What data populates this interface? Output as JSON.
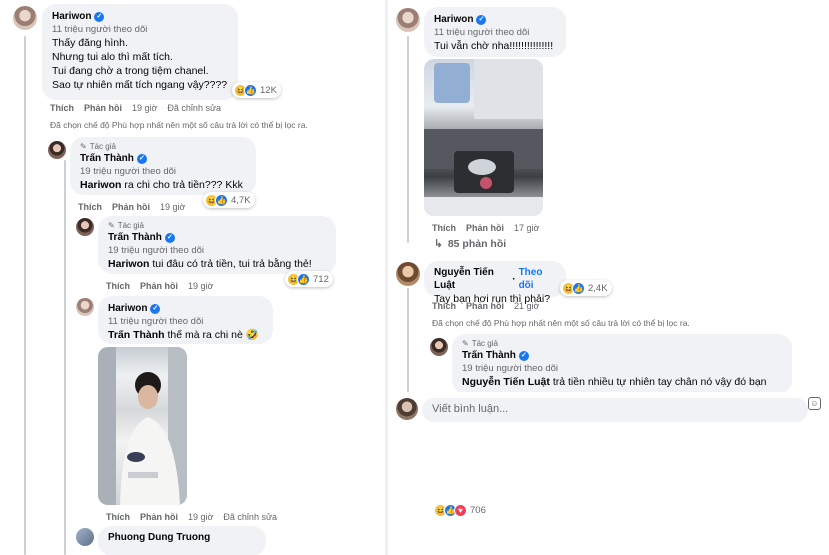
{
  "left": {
    "c1": {
      "name": "Hariwon",
      "followers": "11 triệu người theo dõi",
      "lines": [
        "Thấy đăng hình.",
        "Nhưng tui alo thì mất tích.",
        "Tui đang chờ a trong tiệm chanel.",
        "Sao tự nhiên mất tích ngang vậy????"
      ],
      "react_count": "12K",
      "like": "Thích",
      "reply": "Phản hồi",
      "time": "19 giờ",
      "edited": "Đã chỉnh sửa"
    },
    "filter_note": "Đã chọn chế độ Phù hợp nhất nên một số câu trả lời có thể bị lọc ra.",
    "c2": {
      "author_tag": "Tác giả",
      "name": "Trấn Thành",
      "followers": "19 triệu người theo dõi",
      "mention": "Hariwon",
      "text": " ra chi cho trả tiền??? Kkk",
      "react_count": "4,7K",
      "like": "Thích",
      "reply": "Phản hồi",
      "time": "19 giờ"
    },
    "c3": {
      "author_tag": "Tác giả",
      "name": "Trấn Thành",
      "followers": "19 triệu người theo dõi",
      "mention": "Hariwon",
      "text": " tui đâu có trả tiền, tui trả bằng thẻ!",
      "react_count": "712",
      "like": "Thích",
      "reply": "Phản hồi",
      "time": "19 giờ"
    },
    "c4": {
      "name": "Hariwon",
      "followers": "11 triệu người theo dõi",
      "mention": "Trấn Thành",
      "text": " thế mà ra chi nè 🤣",
      "like": "Thích",
      "reply": "Phản hồi",
      "time": "19 giờ",
      "edited": "Đã chỉnh sửa"
    },
    "c5": {
      "name": "Phuong Dung Truong"
    }
  },
  "right": {
    "c1": {
      "name": "Hariwon",
      "followers": "11 triệu người theo dõi",
      "text": "Tui vẫn chờ nha!!!!!!!!!!!!!!!",
      "like": "Thích",
      "reply": "Phản hồi",
      "time": "17 giờ",
      "replies_link": "85 phản hồi"
    },
    "c2": {
      "name": "Nguyễn Tiến Luật",
      "follow": "Theo dõi",
      "text": "Tay bạn hơi run thì phải?",
      "react_count": "2,4K",
      "like": "Thích",
      "reply": "Phản hồi",
      "time": "21 giờ"
    },
    "filter_note": "Đã chọn chế độ Phù hợp nhất nên một số câu trả lời có thể bị lọc ra.",
    "c3": {
      "author_tag": "Tác giả",
      "name": "Trấn Thành",
      "followers": "19 triệu người theo dõi",
      "mention": "Nguyễn Tiến Luật",
      "text": " trả tiền nhiều tự nhiên tay chân nó vậy đó bạn"
    },
    "composer": {
      "placeholder": "Viết bình luận..."
    },
    "post_react_count": "706"
  },
  "icons": {
    "verified": "verified-badge-icon",
    "pencil": "pencil-icon",
    "haha": "haha-reaction-icon",
    "like": "like-reaction-icon",
    "love": "love-reaction-icon",
    "reply_arrow": "reply-arrow-icon",
    "emoji": "emoji-icon"
  },
  "colors": {
    "accent": "#1877f2",
    "bubble": "#f0f2f5",
    "muted": "#65676b"
  }
}
